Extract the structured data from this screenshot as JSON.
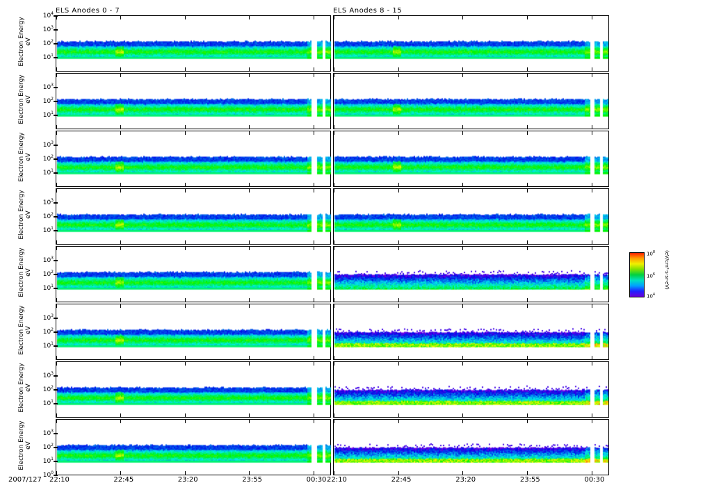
{
  "chart_data": {
    "type": "heatmap",
    "columns": [
      {
        "title": "ELS Anodes 0 - 7",
        "panels": 8
      },
      {
        "title": "ELS Anodes 8 - 15",
        "panels": 8
      }
    ],
    "ylabel": "Electron Energy",
    "yunit": "eV",
    "yscale": "log",
    "ylim": [
      1,
      10000
    ],
    "ytick_labels": {
      "top": "10",
      "top_exp": "4",
      "t3": "10",
      "t3_exp": "3",
      "t2": "10",
      "t2_exp": "2",
      "t1": "10",
      "t1_exp": "1",
      "bottom": "10",
      "bottom_exp": "0"
    },
    "date_label": "2007/127",
    "xtick_labels": [
      "22:10",
      "22:45",
      "23:20",
      "23:55",
      "00:30"
    ],
    "x_minutes": [
      0,
      35,
      70,
      105,
      140
    ],
    "xlim_minutes": [
      0,
      150
    ],
    "data_gaps_minutes": [
      [
        139,
        141.5
      ],
      [
        144.5,
        146
      ]
    ],
    "band_eV": [
      10,
      150
    ],
    "colorbar": {
      "labels": [
        {
          "base": "10",
          "exp": "8"
        },
        {
          "base": "10",
          "exp": "6"
        },
        {
          "base": "10",
          "exp": "4"
        }
      ],
      "unit": "(eV/cm²-s-sr-eV)",
      "colormap": "rainbow"
    }
  }
}
